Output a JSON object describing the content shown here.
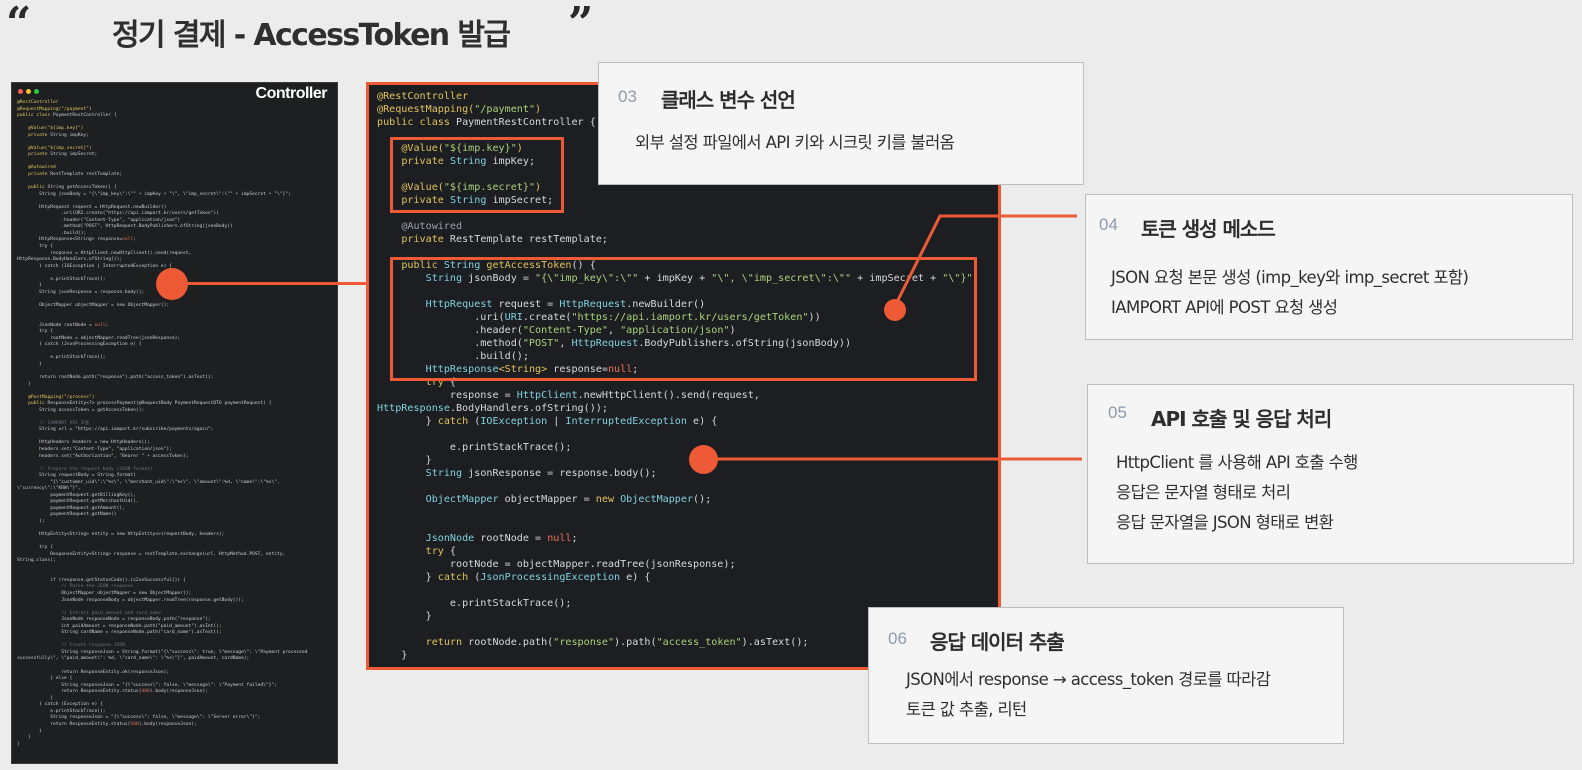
{
  "header": {
    "open_quote": "“",
    "close_quote": "”",
    "title": "정기 결제 - AccessToken 발급"
  },
  "controller_thumbnail": {
    "label": "Controller",
    "window_dot_colors": [
      "#ff5f56",
      "#ffbd2e",
      "#27c93f"
    ]
  },
  "code_panel": {
    "language": "Java",
    "highlight_color": "#ee5a36"
  },
  "callouts": [
    {
      "number": "03",
      "heading": "클래스 변수 선언",
      "lines": [
        "외부 설정 파일에서 API 키와 시크릿 키를 불러옴"
      ]
    },
    {
      "number": "04",
      "heading": "토큰 생성 메소드",
      "lines": [
        "JSON 요청 본문 생성 (imp_key와 imp_secret 포함)",
        " IAMPORT API에 POST 요청 생성"
      ]
    },
    {
      "number": "05",
      "heading": "API 호출 및 응답 처리",
      "lines": [
        "HttpClient 를 사용해 API 호출 수행",
        "응답은 문자열 형태로 처리",
        "응답 문자열을 JSON 형태로 변환"
      ]
    },
    {
      "number": "06",
      "heading": "응답 데이터 추출",
      "lines": [
        "JSON에서 response → access_token 경로를 따라감",
        "토큰 값 추출, 리턴"
      ]
    }
  ]
}
